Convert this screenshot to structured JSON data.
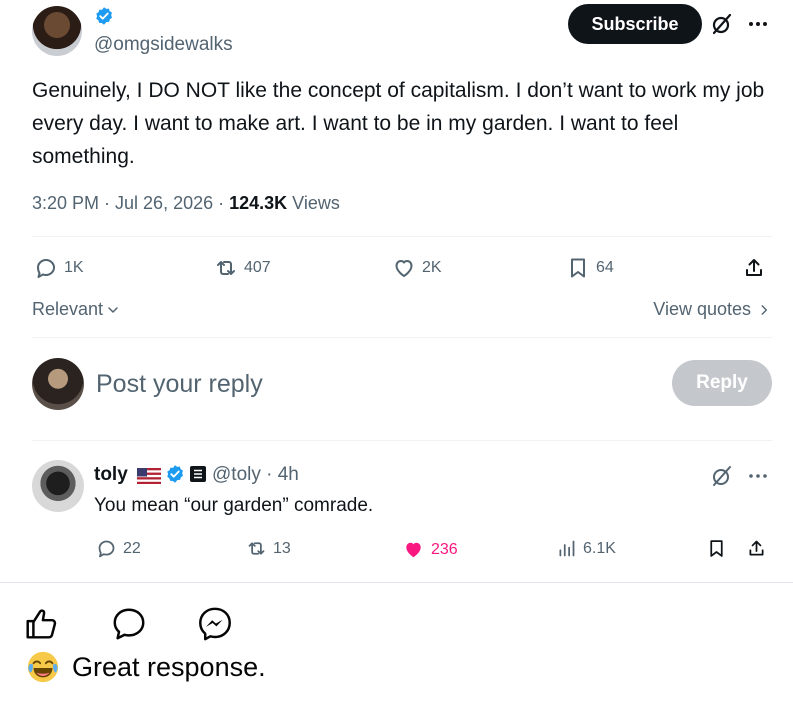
{
  "post": {
    "handle": "@omgsidewalks",
    "subscribe_label": "Subscribe",
    "text": "Genuinely, I DO NOT like the concept of capitalism. I don’t want to work my job every day. I want to make art. I want to be in my garden. I want to feel something.",
    "time": "3:20 PM · Jul 26, 2026 · ",
    "views_count": "124.3K",
    "views_label": " Views",
    "replies": "1K",
    "reposts": "407",
    "likes": "2K",
    "bookmarks": "64"
  },
  "sort": {
    "label": "Relevant",
    "view_quotes": "View quotes"
  },
  "composer": {
    "placeholder": "Post your reply",
    "reply_label": "Reply"
  },
  "reply": {
    "name": "toly",
    "handle": "@toly · 4h",
    "text": "You mean “our garden” comrade.",
    "replies": "22",
    "reposts": "13",
    "likes": "236",
    "views": "6.1K"
  },
  "facebook": {
    "comment": "Great response."
  },
  "colors": {
    "accent": "#1d9bf0",
    "like_pink": "#f91880",
    "muted": "#536471",
    "text": "#0f1419"
  },
  "icons": [
    "verified-icon",
    "grok-icon",
    "more-icon",
    "reply-icon",
    "repost-icon",
    "like-icon",
    "bookmark-icon",
    "share-icon",
    "chevron-down-icon",
    "chevron-right-icon",
    "flag-icon",
    "views-icon",
    "fb-like-icon",
    "fb-comment-icon",
    "fb-messenger-icon",
    "laughing-emoji-icon"
  ]
}
